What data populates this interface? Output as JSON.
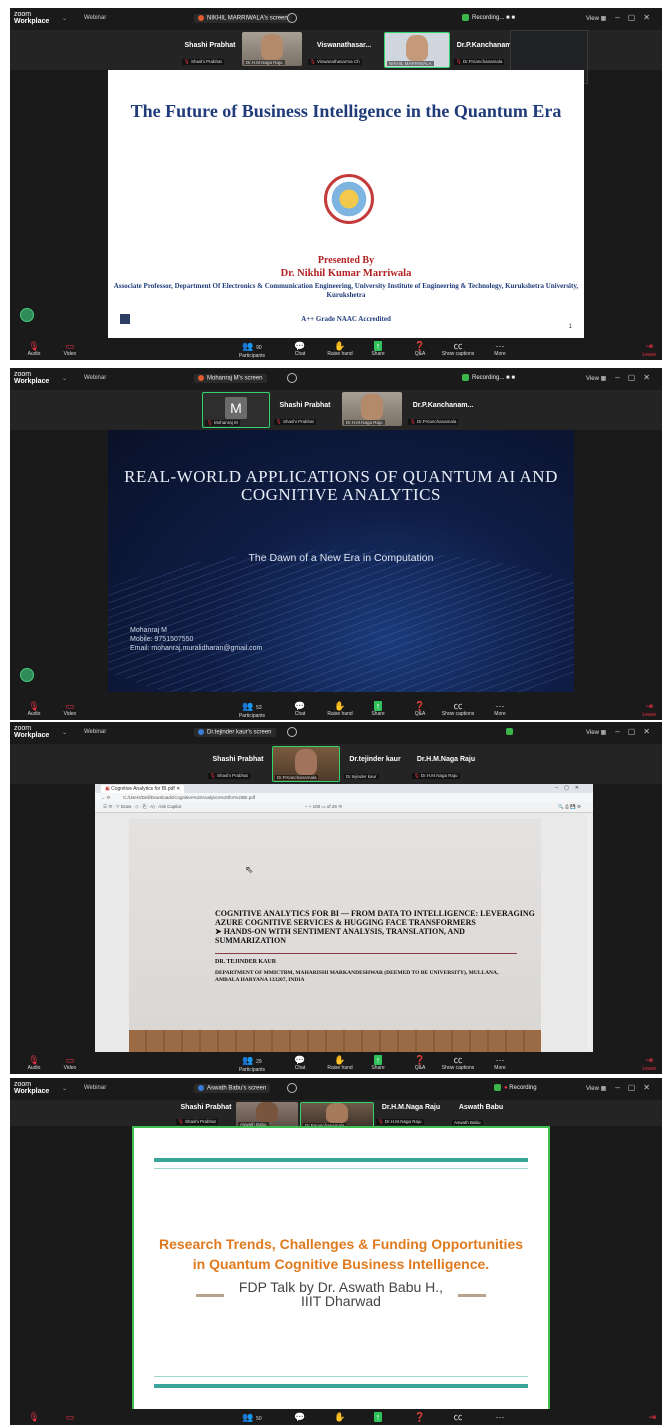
{
  "common": {
    "brand_line1": "zoom",
    "brand_line2": "Workplace",
    "webinar": "Webinar",
    "view": "View",
    "toolbar": {
      "audio": "Audio",
      "video": "Video",
      "participants": "Participants",
      "chat": "Chat",
      "raise_hand": "Raise hand",
      "share": "Share",
      "qa": "Q&A",
      "captions": "Show captions",
      "more": "More",
      "leave": "Leave"
    },
    "colors": {
      "accent_green": "#2fd46a",
      "leave_red": "#e33344",
      "zoom_bg": "#1a1a1a"
    }
  },
  "shots": [
    {
      "screen_name": "NIKHIL MARRIWALA's screen",
      "status": "Recording...",
      "participant_count": "90",
      "tiles": [
        {
          "name": "Shashi Prabhat",
          "sub": "Shashi Prabhat"
        },
        {
          "name": "",
          "sub": "Dr.H.M.Naga Raju"
        },
        {
          "name": "Viswanathasar...",
          "sub": "Viswanathasarma Ch"
        },
        {
          "name": "",
          "sub": "NIKHIL MARRIWALA"
        },
        {
          "name": "Dr.P.Kanchanam...",
          "sub": "Dr.P.Kanchanamala"
        }
      ],
      "slide": {
        "title": "The Future of Business Intelligence in the Quantum Era",
        "presented_by": "Presented By",
        "presenter": "Dr. Nikhil Kumar Marriwala",
        "designation": "Associate Professor, Department Of Electronics & Communication Engineering, University Institute of Engineering & Technology, Kurukshetra University, Kurukshetra",
        "naac": "A++ Grade NAAC Accredited",
        "page": "1"
      }
    },
    {
      "screen_name": "Mohanraj M's screen",
      "status": "Recording...",
      "participant_count": "53",
      "tiles": [
        {
          "name": "M",
          "sub": "Mohanraj M"
        },
        {
          "name": "Shashi Prabhat",
          "sub": "Shashi Prabhat"
        },
        {
          "name": "",
          "sub": "Dr.H.M.Naga Raju"
        },
        {
          "name": "Dr.P.Kanchanam...",
          "sub": "Dr.P.Kanchanamala"
        }
      ],
      "slide": {
        "title": "REAL-WORLD APPLICATIONS OF QUANTUM AI AND COGNITIVE ANALYTICS",
        "subtitle": "The Dawn of a New Era in Computation",
        "name": "Mohanraj M",
        "mobile": "Mobile: 9751507550",
        "email": "Email: mohanraj.muralidharan@gmail.com"
      }
    },
    {
      "screen_name": "Dr.tejinder kaur's screen",
      "status": "",
      "participant_count": "29",
      "tiles": [
        {
          "name": "Shashi Prabhat",
          "sub": "Shashi Prabhat"
        },
        {
          "name": "",
          "sub": "Dr.P.Kanchanamala"
        },
        {
          "name": "Dr.tejinder kaur",
          "sub": "Dr.tejinder kaur"
        },
        {
          "name": "Dr.H.M.Naga Raju",
          "sub": "Dr.H.M.Naga Raju"
        }
      ],
      "browser": {
        "tab": "Cognitive Analytics for BI.pdf",
        "url": "C:/Users/Dell/Downloads/Cognitive%20Analytics%20for%20BI.pdf",
        "draw": "Draw",
        "ask": "Ask Copilot",
        "zoom": "100",
        "pages": "of 25"
      },
      "slide": {
        "title": "COGNITIVE ANALYTICS FOR BI — FROM DATA TO INTELLIGENCE: LEVERAGING AZURE COGNITIVE SERVICES & HUGGING FACE TRANSFORMERS",
        "bullet": "➤ HANDS-ON WITH SENTIMENT ANALYSIS, TRANSLATION, AND SUMMARIZATION",
        "author": "DR. TEJINDER KAUR",
        "dept": "DEPARTMENT OF MMICTBM, MAHARISHI MARKANDESHWAR (DEEMED TO BE UNIVERSITY), MULLANA, AMBALA HARYANA 133207, INDIA"
      }
    },
    {
      "screen_name": "Aswath Babu's screen",
      "status": "Recording",
      "participant_count": "50",
      "tiles": [
        {
          "name": "Shashi Prabhat",
          "sub": "Shashi Prabhat"
        },
        {
          "name": "",
          "sub": "Aswath Babu"
        },
        {
          "name": "",
          "sub": "Dr.P.Kanchanamala"
        },
        {
          "name": "Dr.H.M.Naga Raju",
          "sub": "Dr.H.M.Naga Raju"
        },
        {
          "name": "Aswath Babu",
          "sub": "Aswath Babu"
        }
      ],
      "slide": {
        "title_line1": "Research Trends, Challenges & Funding Opportunities",
        "title_line2": "in Quantum Cognitive Business Intelligence.",
        "sub_line1": "FDP Talk by Dr. Aswath Babu H.,",
        "sub_line2": "IIIT Dharwad"
      }
    }
  ]
}
